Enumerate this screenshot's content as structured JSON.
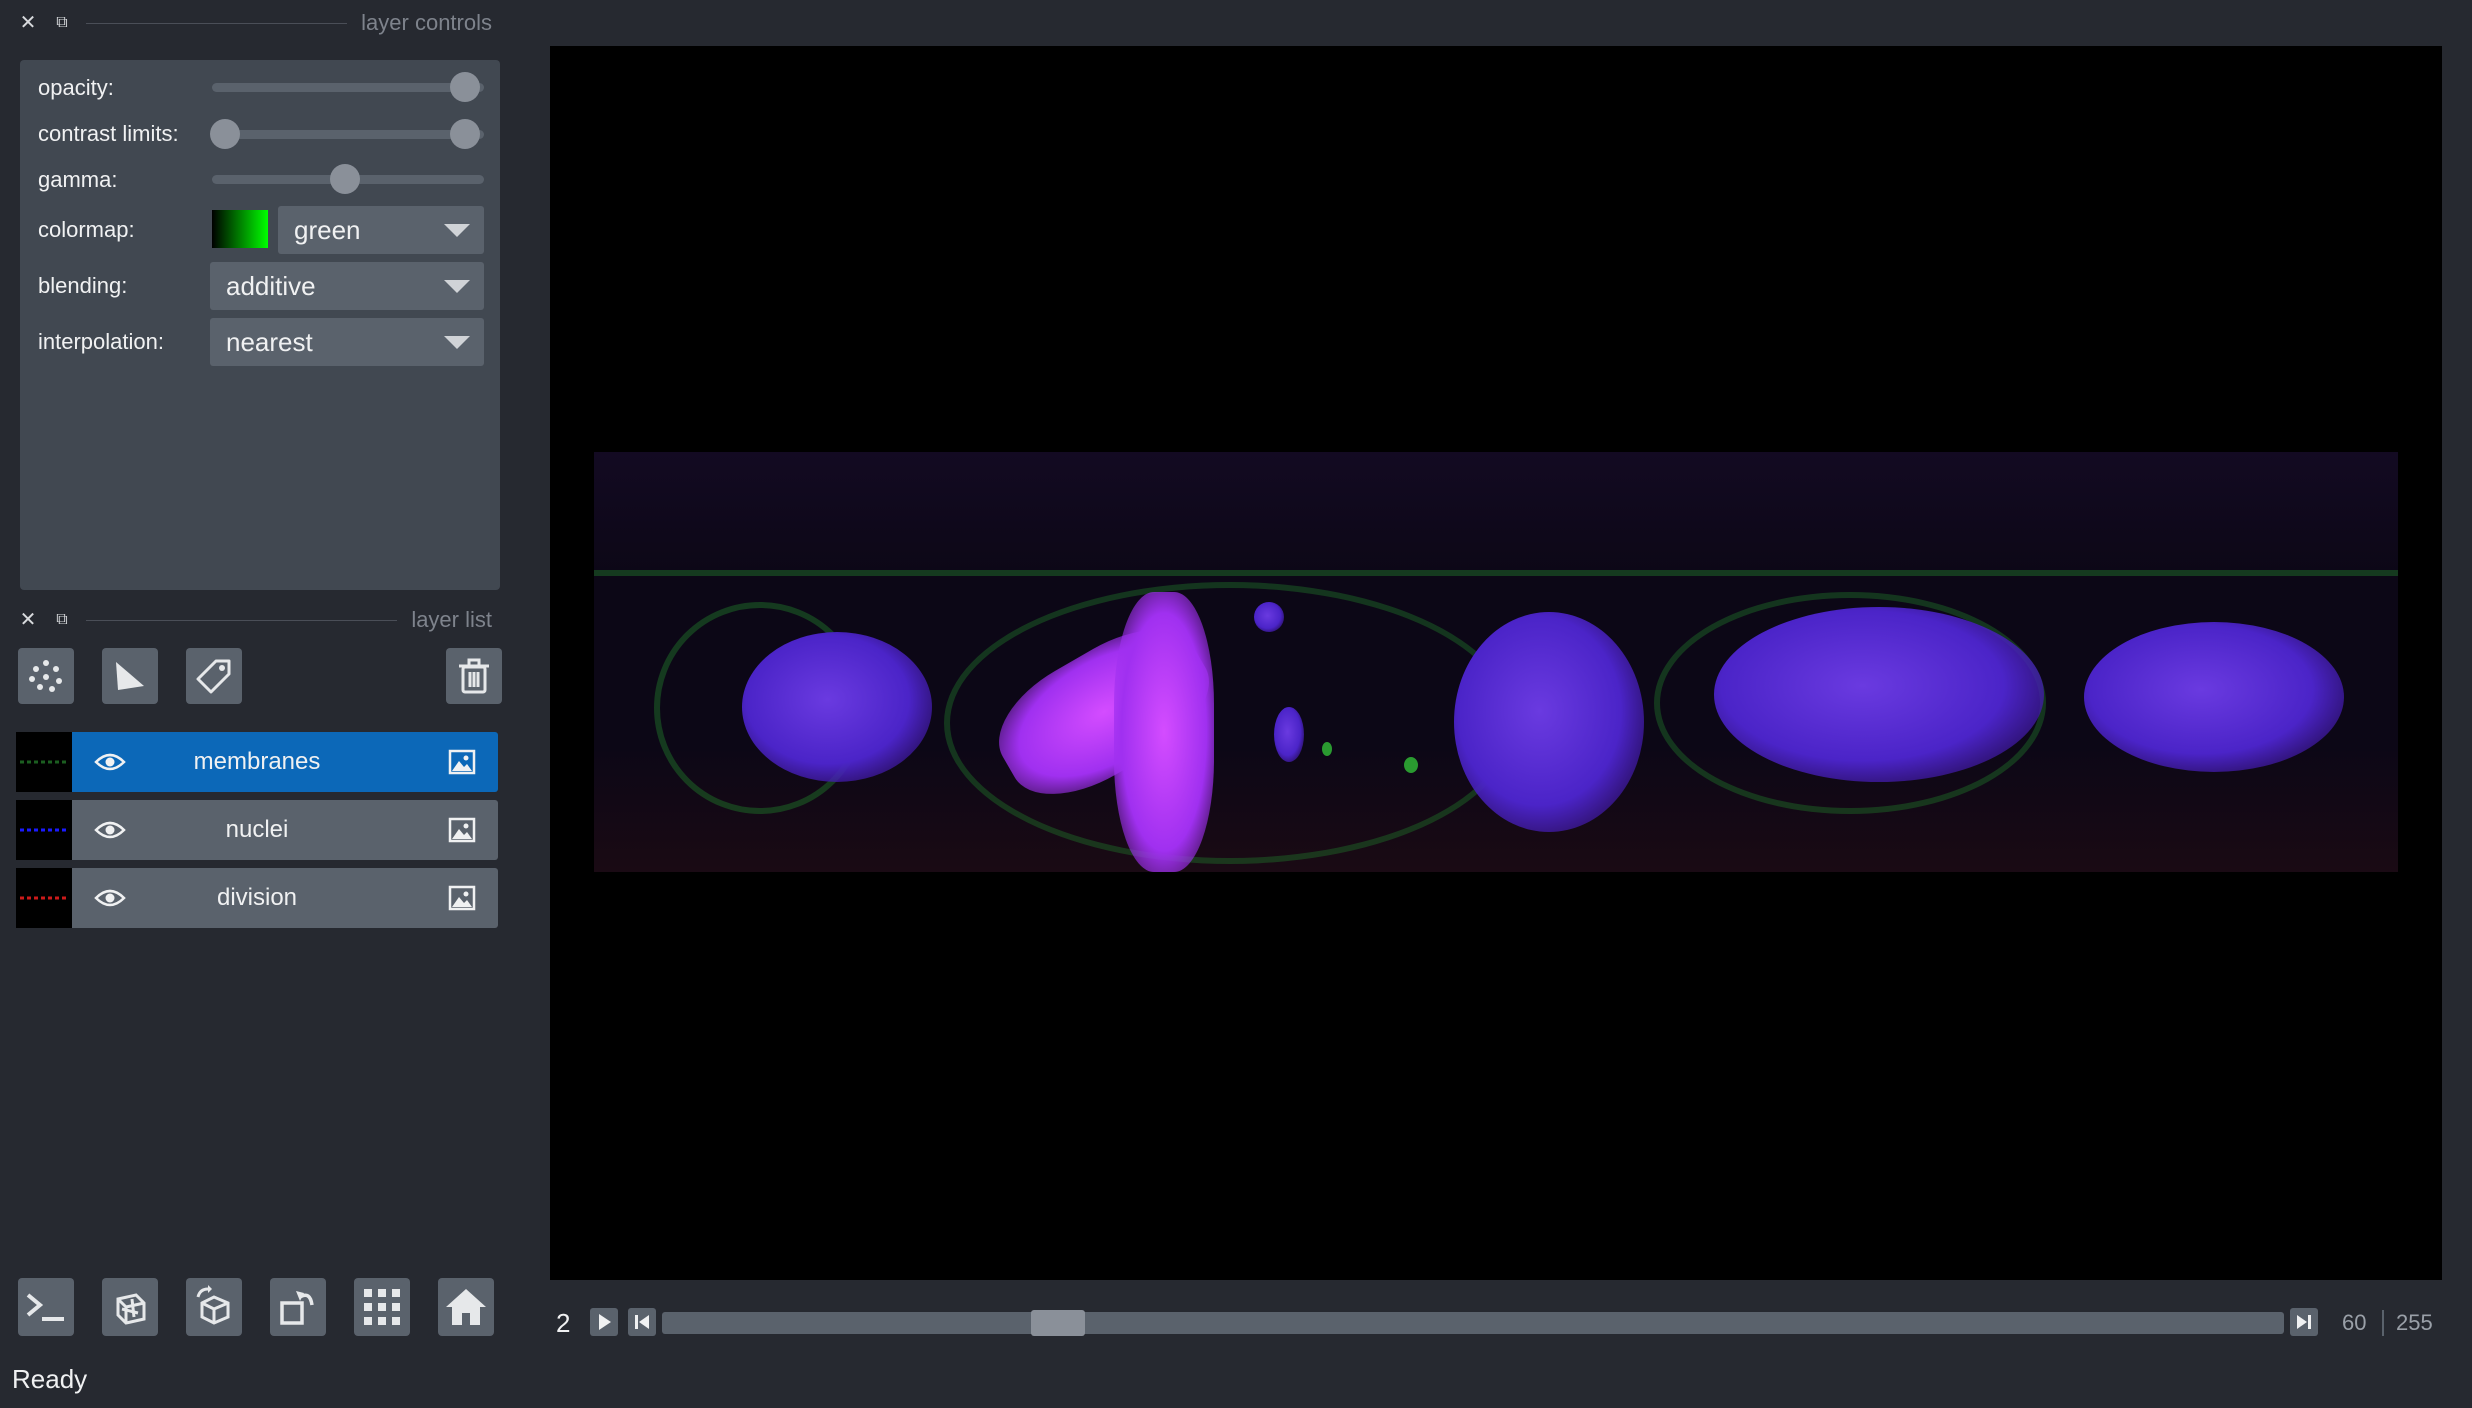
{
  "layer_controls": {
    "title": "layer controls",
    "opacity_label": "opacity:",
    "opacity_value": 1.0,
    "contrast_label": "contrast limits:",
    "contrast_range": [
      0.0,
      1.0
    ],
    "gamma_label": "gamma:",
    "gamma_value": 0.5,
    "colormap_label": "colormap:",
    "colormap_value": "green",
    "blending_label": "blending:",
    "blending_value": "additive",
    "interpolation_label": "interpolation:",
    "interpolation_value": "nearest"
  },
  "layer_list": {
    "title": "layer list",
    "layers": [
      {
        "name": "membranes",
        "selected": true,
        "thumb_color": "#1b5e20"
      },
      {
        "name": "nuclei",
        "selected": false,
        "thumb_color": "#1a1aff"
      },
      {
        "name": "division",
        "selected": false,
        "thumb_color": "#cc1a1a"
      }
    ]
  },
  "dims": {
    "current_step": "2",
    "slider_value": 60,
    "slider_max": 255,
    "value_label": "60",
    "max_label": "255"
  },
  "status": {
    "text": "Ready"
  },
  "colors": {
    "background": "#262930",
    "panel": "#414851",
    "button": "#5a626c",
    "selected": "#0c68b8"
  },
  "icons": {
    "close": "close-icon",
    "float": "float-icon",
    "new_points": "points-icon",
    "new_shapes": "shapes-icon",
    "new_labels": "labels-icon",
    "delete": "trash-icon",
    "console": "console-icon",
    "ndisplay": "ndisplay-icon",
    "roll": "roll-icon",
    "transpose": "transpose-icon",
    "grid": "grid-icon",
    "home": "home-icon",
    "play": "play-icon",
    "first": "first-frame-icon",
    "last": "last-frame-icon",
    "eye": "eye-icon",
    "image": "image-icon"
  }
}
